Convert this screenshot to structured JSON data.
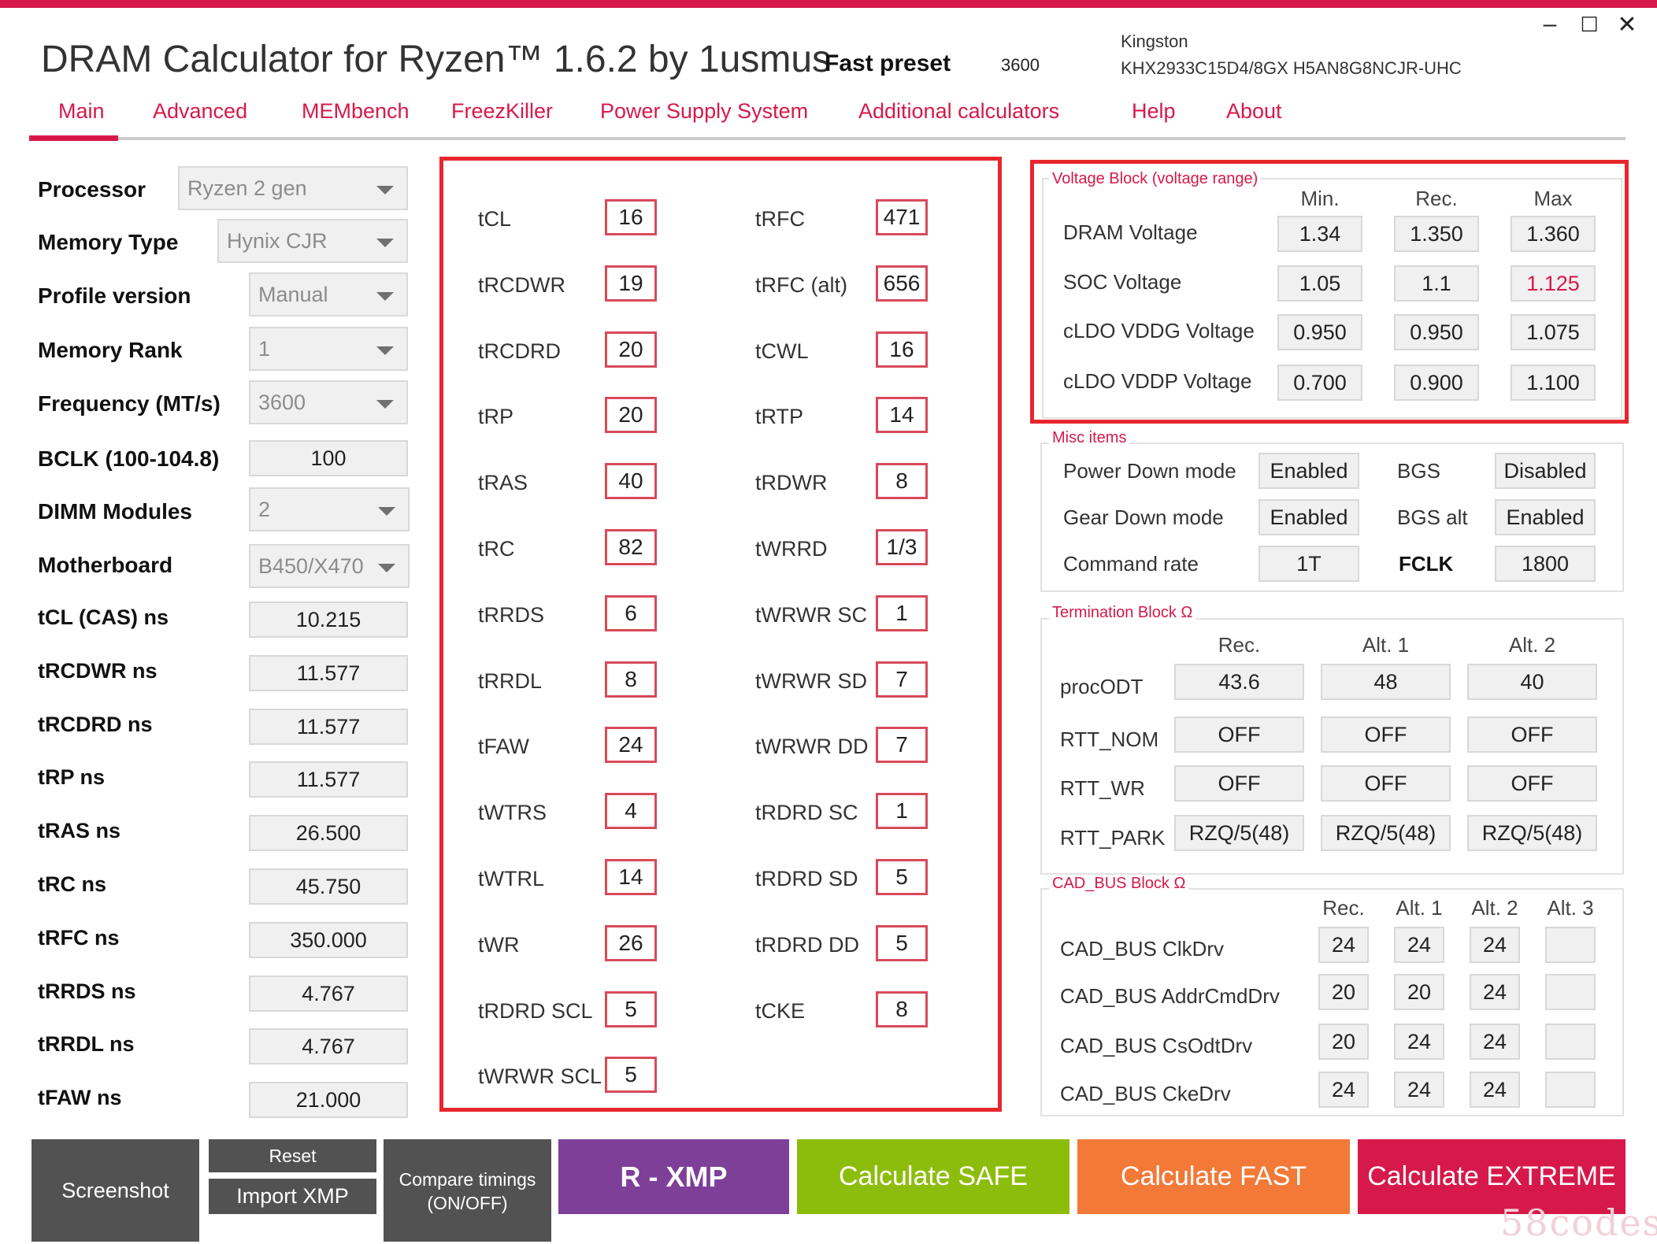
{
  "window": {
    "title": "DRAM Calculator for Ryzen™ 1.6.2 by 1usmus",
    "preset_label": "Fast preset",
    "preset_value": "3600",
    "vendor": "Kingston",
    "module": "KHX2933C15D4/8GX H5AN8G8NCJR-UHC",
    "minimize_glyph": "–",
    "maximize_glyph": "☐",
    "close_glyph": "✕"
  },
  "tabs": [
    "Main",
    "Advanced",
    "MEMbench",
    "FreezKiller",
    "Power Supply System",
    "Additional calculators",
    "Help",
    "About"
  ],
  "active_tab": "Main",
  "left_panel": {
    "dropdowns": [
      {
        "label": "Processor",
        "value": "Ryzen 2 gen"
      },
      {
        "label": "Memory Type",
        "value": "Hynix CJR"
      },
      {
        "label": "Profile version",
        "value": "Manual"
      },
      {
        "label": "Memory Rank",
        "value": "1"
      },
      {
        "label": "Frequency (MT/s)",
        "value": "3600"
      }
    ],
    "bclk": {
      "label": "BCLK (100-104.8)",
      "value": "100"
    },
    "dimm": {
      "label": "DIMM Modules",
      "value": "2"
    },
    "motherboard": {
      "label": "Motherboard",
      "value": "B450/X470"
    },
    "ns_values": [
      {
        "label": "tCL (CAS) ns",
        "value": "10.215"
      },
      {
        "label": "tRCDWR ns",
        "value": "11.577"
      },
      {
        "label": "tRCDRD ns",
        "value": "11.577"
      },
      {
        "label": "tRP ns",
        "value": "11.577"
      },
      {
        "label": "tRAS ns",
        "value": "26.500"
      },
      {
        "label": "tRC ns",
        "value": "45.750"
      },
      {
        "label": "tRFC ns",
        "value": "350.000"
      },
      {
        "label": "tRRDS ns",
        "value": "4.767"
      },
      {
        "label": "tRRDL ns",
        "value": "4.767"
      },
      {
        "label": "tFAW ns",
        "value": "21.000"
      }
    ]
  },
  "timings": {
    "left": [
      {
        "label": "tCL",
        "value": "16"
      },
      {
        "label": "tRCDWR",
        "value": "19"
      },
      {
        "label": "tRCDRD",
        "value": "20"
      },
      {
        "label": "tRP",
        "value": "20"
      },
      {
        "label": "tRAS",
        "value": "40"
      },
      {
        "label": "tRC",
        "value": "82"
      },
      {
        "label": "tRRDS",
        "value": "6"
      },
      {
        "label": "tRRDL",
        "value": "8"
      },
      {
        "label": "tFAW",
        "value": "24"
      },
      {
        "label": "tWTRS",
        "value": "4"
      },
      {
        "label": "tWTRL",
        "value": "14"
      },
      {
        "label": "tWR",
        "value": "26"
      },
      {
        "label": "tRDRD SCL",
        "value": "5"
      },
      {
        "label": "tWRWR SCL",
        "value": "5"
      }
    ],
    "right": [
      {
        "label": "tRFC",
        "value": "471"
      },
      {
        "label": "tRFC (alt)",
        "value": "656"
      },
      {
        "label": "tCWL",
        "value": "16"
      },
      {
        "label": "tRTP",
        "value": "14"
      },
      {
        "label": "tRDWR",
        "value": "8"
      },
      {
        "label": "tWRRD",
        "value": "1/3"
      },
      {
        "label": "tWRWR SC",
        "value": "1"
      },
      {
        "label": "tWRWR SD",
        "value": "7"
      },
      {
        "label": "tWRWR DD",
        "value": "7"
      },
      {
        "label": "tRDRD SC",
        "value": "1"
      },
      {
        "label": "tRDRD SD",
        "value": "5"
      },
      {
        "label": "tRDRD DD",
        "value": "5"
      },
      {
        "label": "tCKE",
        "value": "8"
      }
    ]
  },
  "voltage": {
    "title": "Voltage Block (voltage range)",
    "headers": [
      "Min.",
      "Rec.",
      "Max"
    ],
    "rows": [
      {
        "label": "DRAM Voltage",
        "values": [
          "1.34",
          "1.350",
          "1.360"
        ]
      },
      {
        "label": "SOC Voltage",
        "values": [
          "1.05",
          "1.1",
          "1.125"
        ]
      },
      {
        "label": "cLDO VDDG Voltage",
        "values": [
          "0.950",
          "0.950",
          "1.075"
        ]
      },
      {
        "label": "cLDO VDDP Voltage",
        "values": [
          "0.700",
          "0.900",
          "1.100"
        ]
      }
    ],
    "highlight_color": "#d6194a"
  },
  "misc": {
    "title": "Misc items",
    "rows": [
      {
        "label": "Power Down mode",
        "value": "Enabled",
        "label2": "BGS",
        "value2": "Disabled"
      },
      {
        "label": "Gear Down mode",
        "value": "Enabled",
        "label2": "BGS alt",
        "value2": "Enabled"
      },
      {
        "label": "Command rate",
        "value": "1T",
        "label2": "FCLK",
        "value2": "1800"
      }
    ]
  },
  "termination": {
    "title": "Termination Block Ω",
    "headers": [
      "Rec.",
      "Alt. 1",
      "Alt. 2"
    ],
    "rows": [
      {
        "label": "procODT",
        "values": [
          "43.6",
          "48",
          "40"
        ]
      },
      {
        "label": "RTT_NOM",
        "values": [
          "OFF",
          "OFF",
          "OFF"
        ]
      },
      {
        "label": "RTT_WR",
        "values": [
          "OFF",
          "OFF",
          "OFF"
        ]
      },
      {
        "label": "RTT_PARK",
        "values": [
          "RZQ/5(48)",
          "RZQ/5(48)",
          "RZQ/5(48)"
        ]
      }
    ]
  },
  "cad_bus": {
    "title": "CAD_BUS Block Ω",
    "headers": [
      "Rec.",
      "Alt. 1",
      "Alt. 2",
      "Alt. 3"
    ],
    "rows": [
      {
        "label": "CAD_BUS ClkDrv",
        "values": [
          "24",
          "24",
          "24",
          ""
        ]
      },
      {
        "label": "CAD_BUS AddrCmdDrv",
        "values": [
          "20",
          "20",
          "24",
          ""
        ]
      },
      {
        "label": "CAD_BUS CsOdtDrv",
        "values": [
          "20",
          "24",
          "24",
          ""
        ]
      },
      {
        "label": "CAD_BUS CkeDrv",
        "values": [
          "24",
          "24",
          "24",
          ""
        ]
      }
    ]
  },
  "buttons": {
    "screenshot": "Screenshot",
    "reset": "Reset",
    "import_xmp": "Import XMP",
    "compare_line1": "Compare timings",
    "compare_line2": "(ON/OFF)",
    "rxmp": "R - XMP",
    "safe": "Calculate SAFE",
    "fast": "Calculate FAST",
    "extreme": "Calculate EXTREME"
  },
  "colors": {
    "accent": "#d6194a",
    "btn_gray": "#525252",
    "btn_purple": "#7d3f98",
    "btn_green": "#8dbd0c",
    "btn_orange": "#f27937",
    "btn_red": "#d6194a",
    "frame_red": "#e8262d"
  },
  "watermark": "58codes"
}
